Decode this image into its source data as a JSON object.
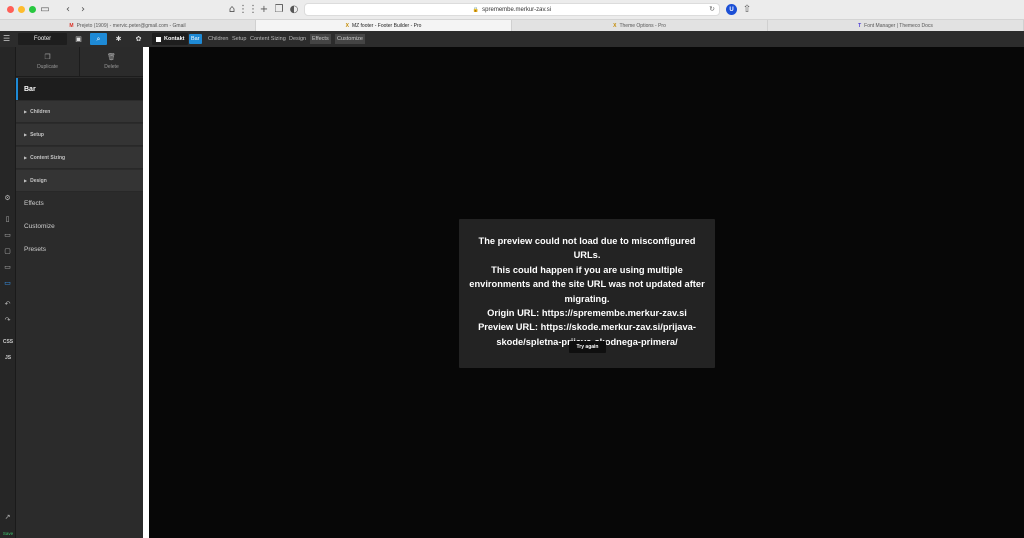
{
  "browser": {
    "url": "spremembe.merkur-zav.si",
    "extension_badge": "U",
    "tabs": [
      {
        "label": "Prejeto (1909) - mervic.peter@gmail.com - Gmail",
        "favicon": "M",
        "active": false
      },
      {
        "label": "MZ footer - Footer Builder - Pro",
        "favicon": "X",
        "active": true
      },
      {
        "label": "Theme Options - Pro",
        "favicon": "X",
        "active": false
      },
      {
        "label": "Font Manager | Themeco Docs",
        "favicon": "T",
        "active": false
      }
    ]
  },
  "builder": {
    "footer_selector": "Footer",
    "element_label": "Kontakt",
    "breadcrumb_tabs": [
      "Bar",
      "Children",
      "Setup",
      "Content Sizing",
      "Design",
      "Effects",
      "Customize"
    ]
  },
  "rail": {
    "css_label": "CSS",
    "js_label": "JS",
    "save_label": "Save"
  },
  "panel": {
    "duplicate_label": "Duplicate",
    "delete_label": "Delete",
    "title": "Bar",
    "sections": [
      "Children",
      "Setup",
      "Content Sizing",
      "Design"
    ],
    "links": [
      "Effects",
      "Customize",
      "Presets"
    ]
  },
  "preview_error": {
    "lines": [
      "The preview could not load due to misconfigured URLs.",
      "This could happen if you are using multiple environments and the site URL was not updated after migrating.",
      "Origin URL: https://spremembe.merkur-zav.si",
      "Preview URL: https://skode.merkur-zav.si/prijava-skode/spletna-prijava-skodnega-primera/"
    ],
    "button_label": "Try again"
  },
  "colors": {
    "accent": "#1e8ad6",
    "save_green": "#3ec46d",
    "canvas_bg": "#070707",
    "modal_bg": "#232323"
  }
}
